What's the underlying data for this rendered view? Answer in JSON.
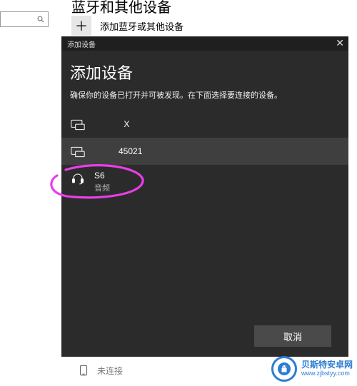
{
  "background": {
    "page_title": "蓝牙和其他设备",
    "add_button_label": "添加蓝牙或其他设备",
    "unconnected_label": "未连接"
  },
  "dialog": {
    "window_title": "添加设备",
    "title": "添加设备",
    "subtitle": "确保你的设备已打开并可被发现。在下面选择要连接的设备。",
    "devices": [
      {
        "name": "X",
        "type": "",
        "highlighted": false,
        "icon": "display-icon"
      },
      {
        "name": "45021",
        "type": "",
        "highlighted": true,
        "icon": "display-icon"
      },
      {
        "name": "S6",
        "type": "音频",
        "highlighted": false,
        "icon": "headset-icon"
      }
    ],
    "cancel_label": "取消"
  },
  "watermark": {
    "brand": "贝斯特安卓网",
    "url": "www.zjbstyy.com"
  }
}
